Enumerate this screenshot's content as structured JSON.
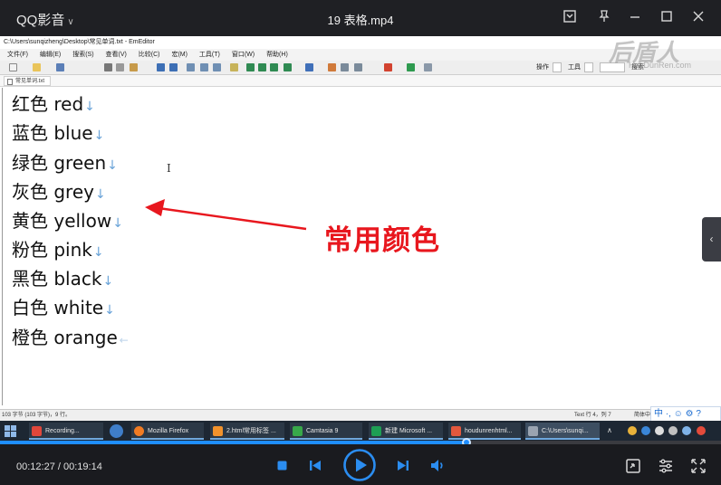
{
  "player": {
    "app_name": "QQ影音",
    "video_title": "19 表格.mp4",
    "current_time": "00:12:27",
    "total_time": "00:19:14",
    "time_separator": " / ",
    "progress": 0.647,
    "accent_color": "#1f8eff"
  },
  "editor": {
    "title": "C:\\Users\\sunqizheng\\Desktop\\常见单词.txt - EmEditor",
    "menu": [
      "文件(F)",
      "编辑(E)",
      "搜索(S)",
      "查看(V)",
      "比较(C)",
      "宏(M)",
      "工具(T)",
      "窗口(W)",
      "帮助(H)"
    ],
    "toolbar_labels": {
      "sort": "操作",
      "tool": "工具",
      "find": "搜索"
    },
    "tab_label": "常见单词.txt",
    "lines": [
      "红色 red",
      "蓝色 blue",
      "绿色 green",
      "灰色 grey",
      "黄色 yellow",
      "粉色 pink",
      "黑色 black",
      "白色 white",
      "橙色 orange"
    ],
    "newline_glyph": "↓",
    "eof_glyph": "←",
    "status_left": "103 字节 (103 字节)，9 行。",
    "status_pos": "Text 行 4，列 7",
    "status_enc": "简体中文"
  },
  "annotation": {
    "text": "常用颜色",
    "color": "#e8171e"
  },
  "watermark": {
    "brand": "后盾人",
    "url": "HouDunRen.com"
  },
  "ime": {
    "text": "中 ·, ☺ ⚙ ?"
  },
  "taskbar": {
    "items": [
      {
        "label": "Recording...",
        "color": "#e0473b"
      },
      {
        "label": "Mozilla Firefox",
        "color": "#f07b23"
      },
      {
        "label": "2.html常用标签 ...",
        "color": "#f1922c"
      },
      {
        "label": "Camtasia 9",
        "color": "#38a84a"
      },
      {
        "label": "新建 Microsoft ...",
        "color": "#1e9e54"
      },
      {
        "label": "houdunrenhtml...",
        "color": "#e2583e"
      },
      {
        "label": "C:\\Users\\sunqi...",
        "color": "#9aa4b1"
      }
    ]
  }
}
